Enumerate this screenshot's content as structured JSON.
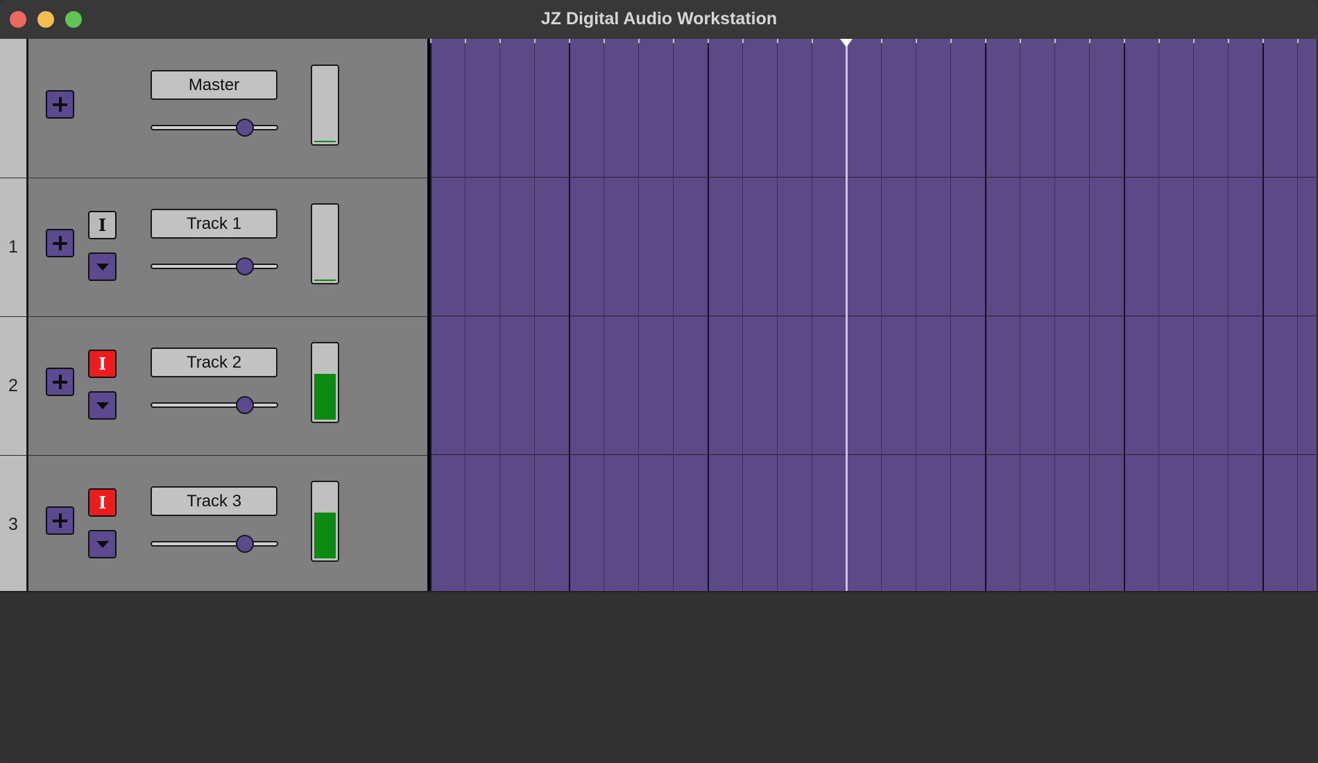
{
  "window": {
    "title": "JZ Digital Audio Workstation",
    "controls": [
      "close",
      "minimize",
      "maximize"
    ]
  },
  "colors": {
    "accent": "#5b4a8f",
    "timeline_bg": "#5c4a88",
    "record_armed": "#ee1c1c",
    "meter_level": "#0d8a12",
    "panel_bg": "#7f7f7f"
  },
  "tracks": [
    {
      "number": "",
      "name": "Master",
      "has_record_button": false,
      "record_armed": false,
      "has_dropdown": false,
      "volume": 0.75,
      "meter_level": 0.01
    },
    {
      "number": "1",
      "name": "Track 1",
      "has_record_button": true,
      "record_armed": false,
      "has_dropdown": true,
      "volume": 0.75,
      "meter_level": 0.01
    },
    {
      "number": "2",
      "name": "Track 2",
      "has_record_button": true,
      "record_armed": true,
      "has_dropdown": true,
      "volume": 0.75,
      "meter_level": 0.62
    },
    {
      "number": "3",
      "name": "Track 3",
      "has_record_button": true,
      "record_armed": true,
      "has_dropdown": true,
      "volume": 0.75,
      "meter_level": 0.62
    }
  ],
  "labels": {
    "record_button": "I"
  },
  "timeline": {
    "bars_visible": 6.4,
    "beats_per_bar": 4,
    "playhead_bar": 3.0
  }
}
